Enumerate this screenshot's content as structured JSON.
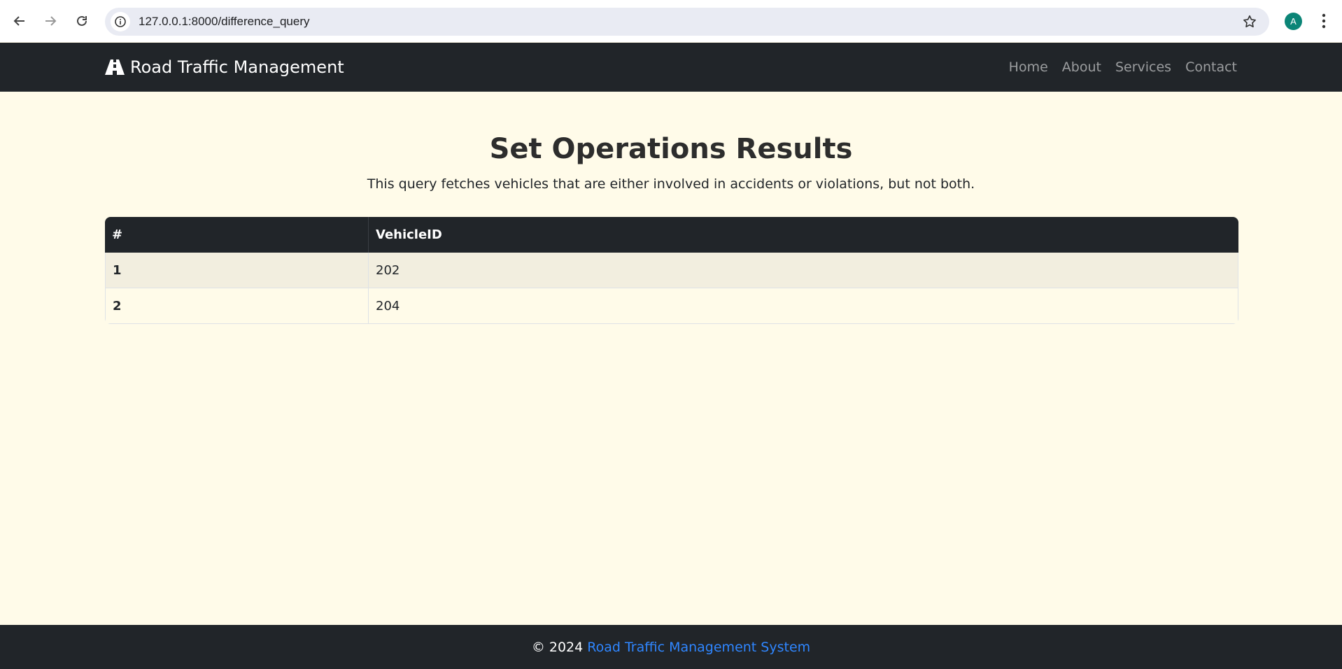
{
  "browser": {
    "url": "127.0.0.1:8000/difference_query",
    "avatar_letter": "A"
  },
  "navbar": {
    "brand": "Road Traffic Management",
    "links": [
      "Home",
      "About",
      "Services",
      "Contact"
    ]
  },
  "main": {
    "title": "Set Operations Results",
    "subtitle": "This query fetches vehicles that are either involved in accidents or violations, but not both.",
    "table": {
      "headers": [
        "#",
        "VehicleID"
      ],
      "rows": [
        {
          "num": "1",
          "vehicle_id": "202"
        },
        {
          "num": "2",
          "vehicle_id": "204"
        }
      ]
    }
  },
  "footer": {
    "prefix": "© 2024",
    "link_text": "Road Traffic Management System"
  },
  "colors": {
    "page_bg": "#fffbe9",
    "navbar_bg": "#212529",
    "link_blue": "#2f86ff",
    "avatar_bg": "#0b8577"
  }
}
